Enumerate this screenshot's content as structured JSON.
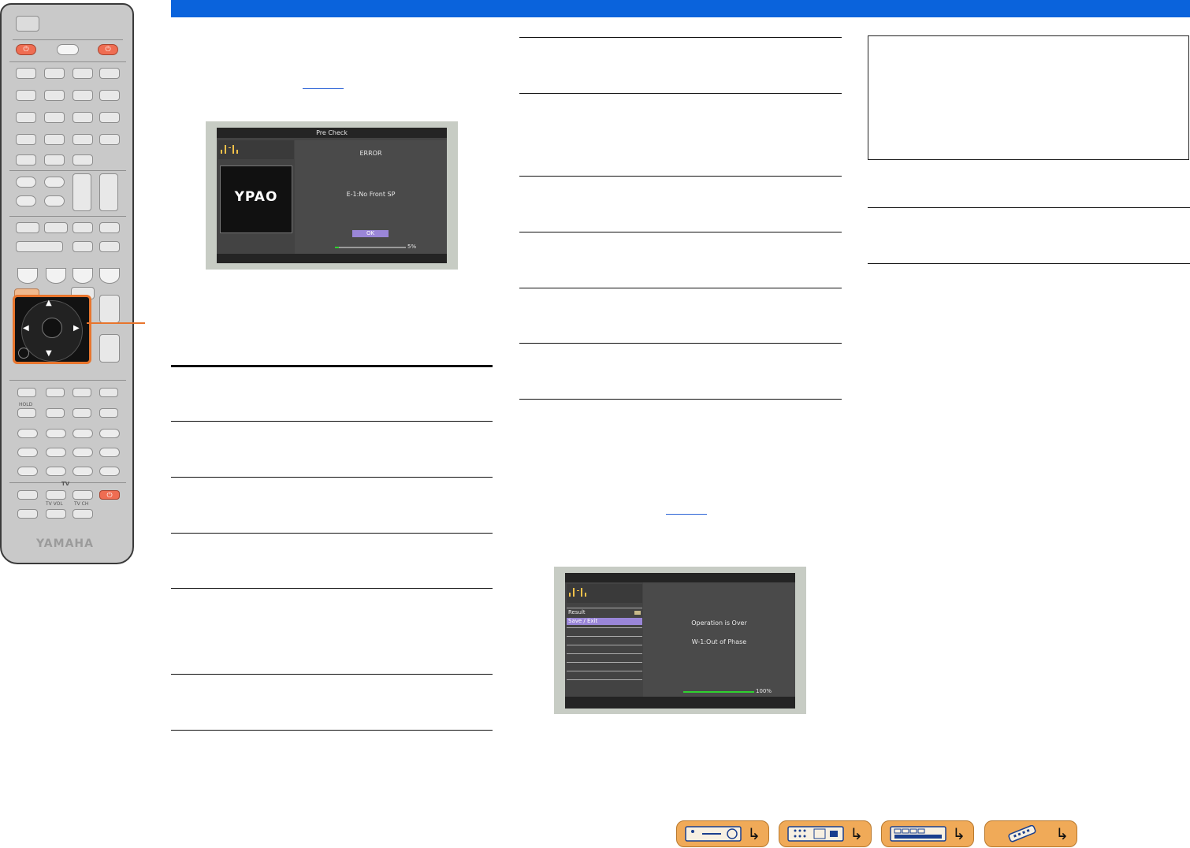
{
  "remote": {
    "hold_label": "HOLD",
    "tv_label": "TV",
    "tv_vol_label": "TV VOL",
    "tv_ch_label": "TV CH",
    "brand": "YAMAHA"
  },
  "precheck_screen": {
    "title": "Pre Check",
    "logo": "YPAO",
    "heading": "ERROR",
    "message": "E-1:No Front SP",
    "ok_label": "OK",
    "progress_label": "5%",
    "progress": 0.05
  },
  "result_screen": {
    "menu": [
      "Result",
      "Save / Exit"
    ],
    "selected": "Save / Exit",
    "line1": "Operation is Over",
    "line2": "W-1:Out of Phase",
    "progress_label": "100%",
    "progress": 1.0
  },
  "colors": {
    "header_bar": "#0a63dc",
    "nav_button": "#f0aa58",
    "highlight": "#e8752d",
    "ok_button": "#9a86d8",
    "progress": "#2fd12f"
  },
  "nav_buttons": [
    {
      "name": "receiver-front-panel-icon"
    },
    {
      "name": "receiver-rear-panel-icon"
    },
    {
      "name": "front-panel-display-icon"
    },
    {
      "name": "remote-control-icon"
    }
  ]
}
